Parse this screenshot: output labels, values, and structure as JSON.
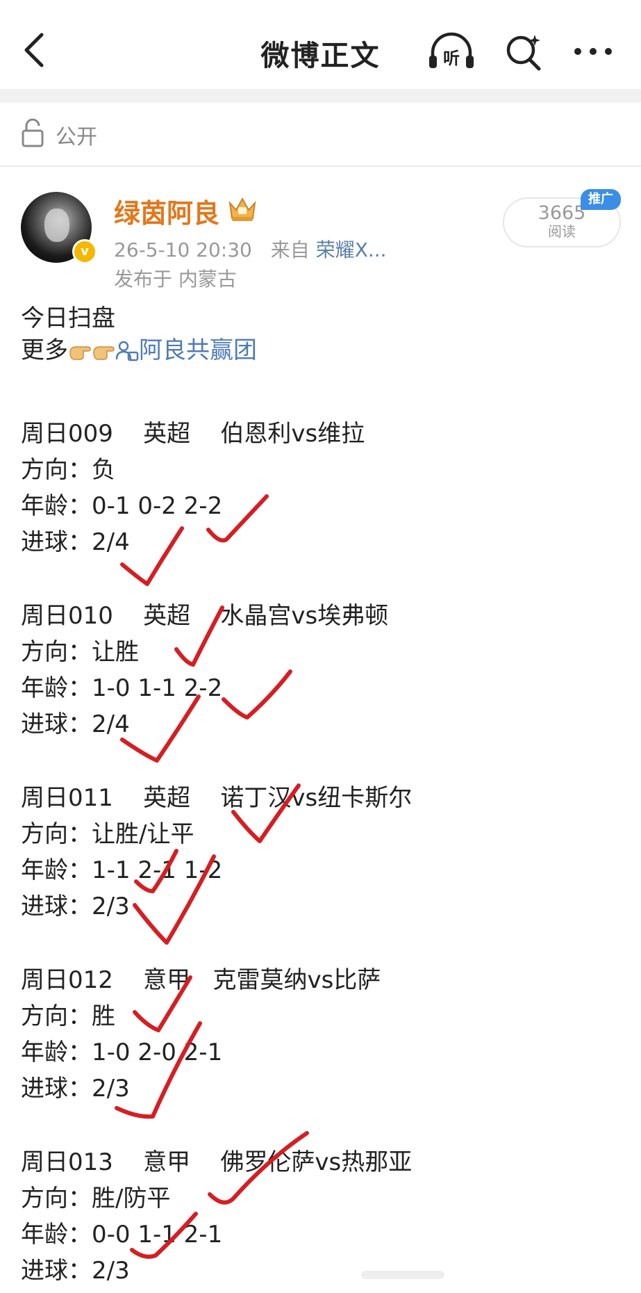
{
  "header": {
    "title": "微博正文",
    "listen_label": "听"
  },
  "privacy": {
    "label": "公开"
  },
  "author": {
    "name": "绿茵阿良",
    "date": "26-5-10 20:30",
    "source_prefix": "来自",
    "source": "荣耀X...",
    "location": "发布于 内蒙古",
    "reads": "3665",
    "reads_label": "阅读",
    "promo": "推广"
  },
  "post": {
    "intro": "今日扫盘",
    "more_prefix": "更多",
    "group_link": "阿良共赢团",
    "matches": [
      {
        "header": "周日009    英超    伯恩利vs维拉",
        "direction": "方向：负",
        "ages": "年龄：0-1 0-2 2-2",
        "goals": "进球：2/4"
      },
      {
        "header": "周日010    英超    水晶宫vs埃弗顿",
        "direction": "方向：让胜",
        "ages": "年龄：1-0 1-1 2-2",
        "goals": "进球：2/4"
      },
      {
        "header": "周日011    英超    诺丁汉vs纽卡斯尔",
        "direction": "方向：让胜/让平",
        "ages": "年龄：1-1 2-1 1-2",
        "goals": "进球：2/3"
      },
      {
        "header": "周日012    意甲   克雷莫纳vs比萨",
        "direction": "方向：胜",
        "ages": "年龄：1-0 2-0 2-1",
        "goals": "进球：2/3"
      },
      {
        "header": "周日013    意甲    佛罗伦萨vs热那亚",
        "direction": "方向：胜/防平",
        "ages": "年龄：0-0 1-1 2-1",
        "goals": "进球：2/3"
      }
    ]
  },
  "colors": {
    "username": "#e2781b",
    "link": "#4f7bb7",
    "check_marks": "#d61e22",
    "promo_badge": "#3a8ee6",
    "v_badge": "#f5b800"
  }
}
